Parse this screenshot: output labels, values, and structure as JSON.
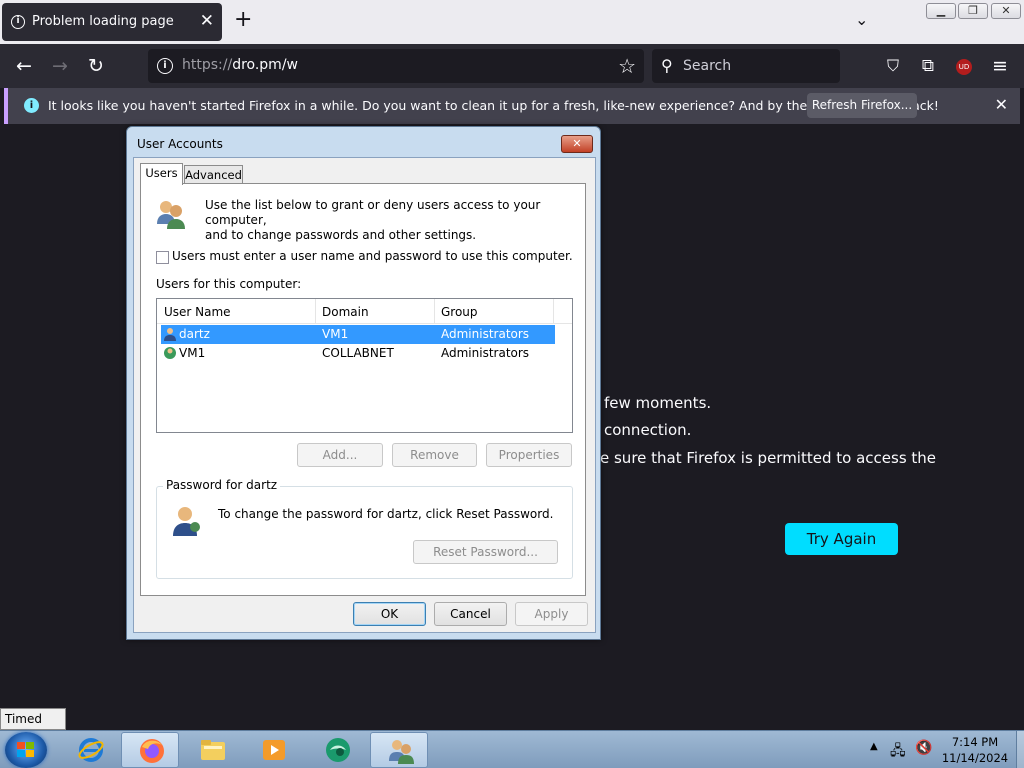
{
  "browser": {
    "tab_title": "Problem loading page",
    "url_protocol": "https://",
    "url_host": "dro.pm/w",
    "search_placeholder": "Search",
    "infobar_message": "It looks like you haven't started Firefox in a while. Do you want to clean it up for a fresh, like-new experience? And by the way, welcome back!",
    "infobar_button": "Refresh Firefox...",
    "status_text": "Timed Out"
  },
  "page": {
    "line1": "few moments.",
    "line2": "connection.",
    "line3": "e sure that Firefox is permitted to access the",
    "try_again": "Try Again"
  },
  "dialog": {
    "title": "User Accounts",
    "tabs": [
      "Users",
      "Advanced"
    ],
    "description_line1": "Use the list below to grant or deny users access to your computer,",
    "description_line2": "and to change passwords and other settings.",
    "checkbox_label": "Users must enter a user name and password to use this computer.",
    "checkbox_checked": false,
    "users_label": "Users for this computer:",
    "columns": [
      "User Name",
      "Domain",
      "Group"
    ],
    "users": [
      {
        "name": "dartz",
        "domain": "VM1",
        "group": "Administrators",
        "selected": true
      },
      {
        "name": "VM1",
        "domain": "COLLABNET",
        "group": "Administrators",
        "selected": false
      }
    ],
    "buttons": {
      "add": "Add...",
      "remove": "Remove",
      "properties": "Properties"
    },
    "password_group": "Password for dartz",
    "password_text": "To change the password for dartz, click Reset Password.",
    "reset_password": "Reset Password...",
    "ok": "OK",
    "cancel": "Cancel",
    "apply": "Apply"
  },
  "taskbar": {
    "time": "7:14 PM",
    "date": "11/14/2024",
    "apps": [
      "internet-explorer",
      "firefox",
      "file-explorer",
      "media-player",
      "app-green",
      "user-accounts"
    ]
  },
  "colors": {
    "accent": "#00ddff",
    "selection": "#3399ff",
    "firefox_dark": "#1c1b22"
  }
}
